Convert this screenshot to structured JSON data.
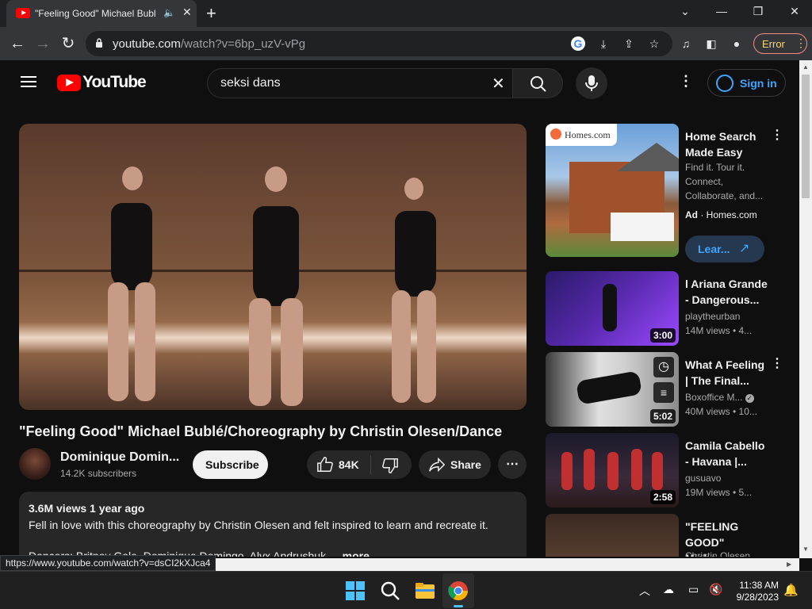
{
  "browser": {
    "tab_title": "\"Feeling Good\" Michael Bubl",
    "url_host": "youtube.com",
    "url_path": "/watch?v=6bp_uzV-vPg",
    "error_label": "Error"
  },
  "youtube": {
    "logo_text": "YouTube",
    "search_query": "seksi dans",
    "signin_label": "Sign in",
    "video": {
      "title": "\"Feeling Good\" Michael Bublé/Choreography by Christin Olesen/Dance",
      "channel": "Dominique Domin...",
      "subscribers": "14.2K subscribers",
      "subscribe_label": "Subscribe",
      "likes": "84K",
      "share_label": "Share",
      "views_date": "3.6M views  1 year ago",
      "description": "Fell in love with this choreography by Christin Olesen and felt inspired to learn and recreate it.",
      "credits": "Dancers: Britney Gale, Dominique Domingo, Alyx Andrushuk ...",
      "more_label": "...more"
    },
    "sidebar": [
      {
        "title": "Home Search Made Easy",
        "line1": "Find it. Tour it. Connect, Collaborate, and...",
        "ad_label": "Ad",
        "ad_source": "Homes.com",
        "cta": "Lear...",
        "brand": "Homes.com"
      },
      {
        "title": "l Ariana Grande - Dangerous...",
        "channel": "playtheurban",
        "views": "14M views  • 4...",
        "duration": "3:00"
      },
      {
        "title": "What A Feeling | The Final...",
        "channel": "Boxoffice M...",
        "views": "40M views  • 10...",
        "duration": "5:02"
      },
      {
        "title": "Camila Cabello - Havana |...",
        "channel": "gusuavo",
        "views": "19M views  • 5...",
        "duration": "2:58"
      },
      {
        "title": "\"FEELING GOOD\" Micha...",
        "channel": "Christin Olesen"
      }
    ]
  },
  "status_url": "https://www.youtube.com/watch?v=dsCI2kXJca4",
  "taskbar": {
    "time": "11:38 AM",
    "date": "9/28/2023"
  }
}
